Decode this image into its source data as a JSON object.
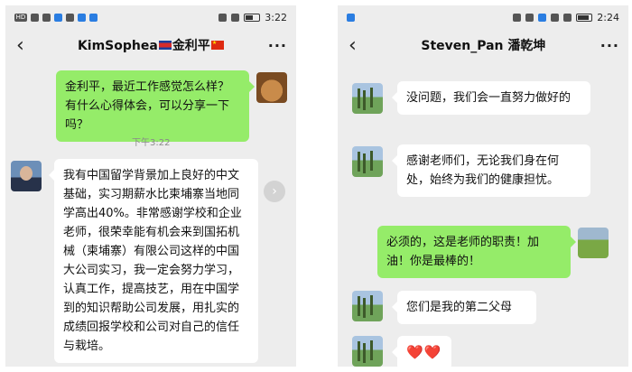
{
  "left": {
    "status": {
      "time": "3:22",
      "hd_label": "HD"
    },
    "title": {
      "name": "KimSophea",
      "name2": "金利平"
    },
    "icons": {
      "back": "chevron-left-icon",
      "more": "more-dots-icon",
      "forward": "forward-icon"
    },
    "messages": [
      {
        "side": "out",
        "text": "金利平，最近工作感觉怎么样？有什么心得体会，可以分享一下吗？"
      },
      {
        "side": "in",
        "text": "我有中国留学背景加上良好的中文基础，实习期薪水比柬埔寨当地同学高出40%。非常感谢学校和企业老师，很荣幸能有机会来到国拓机械（柬埔寨）有限公司这样的中国大公司实习，我一定会努力学习，认真工作，提高技艺，用在中国学到的知识帮助公司发展，用扎实的成绩回报学校和公司对自己的信任与栽培。"
      }
    ],
    "timestamp": "下午3:22"
  },
  "right": {
    "status": {
      "time": "2:24"
    },
    "title": {
      "name": "Steven_Pan 潘乾坤"
    },
    "icons": {
      "back": "chevron-left-icon",
      "more": "more-dots-icon"
    },
    "messages": [
      {
        "side": "in",
        "text": "没问题，我们会一直努力做好的"
      },
      {
        "side": "in",
        "text": "感谢老师们，无论我们身在何处，始终为我们的健康担忧。"
      },
      {
        "side": "out",
        "text": "必须的，这是老师的职责！加油！你是最棒的！"
      },
      {
        "side": "in",
        "text": "您们是我的第二父母"
      },
      {
        "side": "in",
        "text": "❤️❤️"
      }
    ]
  },
  "colors": {
    "chat_bg": "#ededed",
    "sent_bubble": "#95ec69",
    "received_bubble": "#ffffff"
  }
}
